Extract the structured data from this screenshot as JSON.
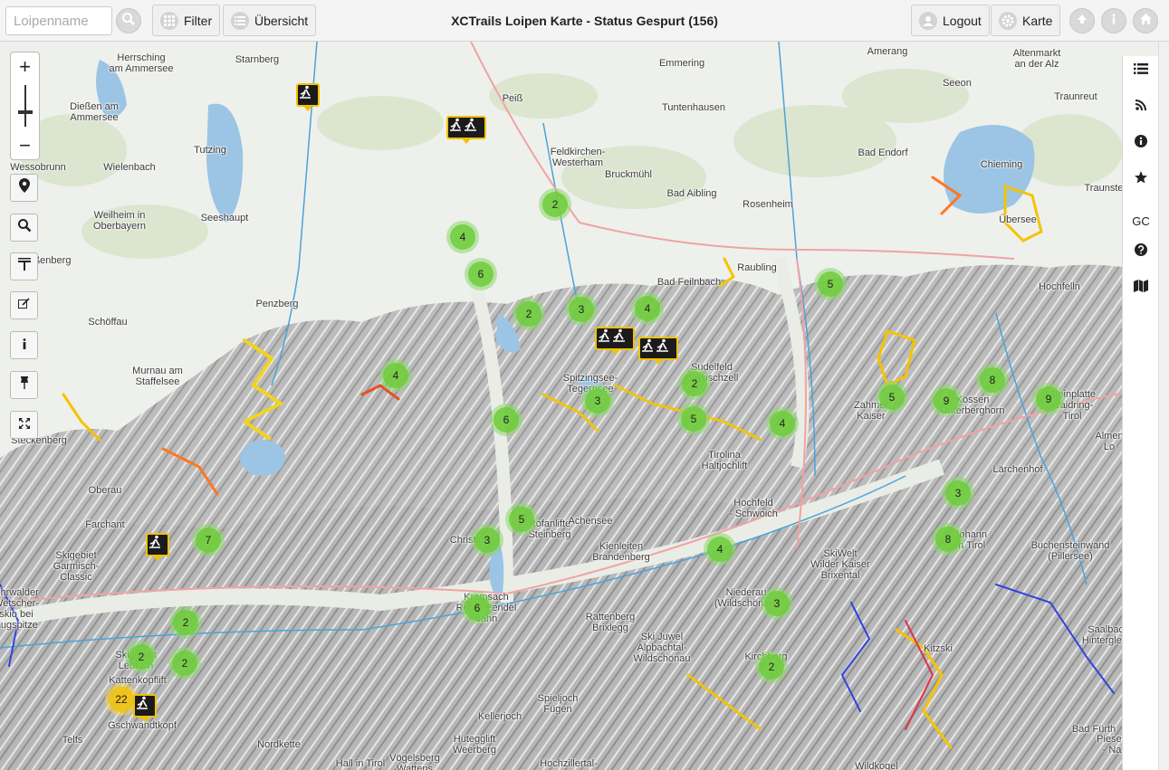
{
  "header": {
    "search_placeholder": "Loipenname",
    "filter_label": "Filter",
    "overview_label": "Übersicht",
    "title": "XCTrails Loipen Karte - Status Gespurt (156)",
    "logout_label": "Logout",
    "map_label": "Karte"
  },
  "map": {
    "zoom_in": "+",
    "zoom_out": "−",
    "places": [
      {
        "name": "Herrsching\nam Ammersee"
      },
      {
        "name": "Starnberg"
      },
      {
        "name": "Dießen am\nAmmersee"
      },
      {
        "name": "Wessobrunn"
      },
      {
        "name": "Wielenbach"
      },
      {
        "name": "Tutzing"
      },
      {
        "name": "Weilheim in\nOberbayern"
      },
      {
        "name": "Seeshaupt"
      },
      {
        "name": "Peißenberg"
      },
      {
        "name": "Penzberg"
      },
      {
        "name": "Schöffau"
      },
      {
        "name": "Murnau am\nStaffelsee"
      },
      {
        "name": "Peiß"
      },
      {
        "name": "Feldkirchen-\nWesterham"
      },
      {
        "name": "Bruckmühl"
      },
      {
        "name": "Bad Aibling"
      },
      {
        "name": "Emmering"
      },
      {
        "name": "Tuntenhausen"
      },
      {
        "name": "Rosenheim"
      },
      {
        "name": "Bad Endorf"
      },
      {
        "name": "Amerang"
      },
      {
        "name": "Seeon"
      },
      {
        "name": "Altenmarkt\nan der Alz"
      },
      {
        "name": "Traunreut"
      },
      {
        "name": "Chieming"
      },
      {
        "name": "Traunste"
      },
      {
        "name": "Übersee"
      },
      {
        "name": "Raubling"
      },
      {
        "name": "Bad Feilnbach"
      },
      {
        "name": "Hochfelln"
      },
      {
        "name": "Spitzingsee-\nTegernsee"
      },
      {
        "name": "Sudelfeld\nBayrischzell"
      },
      {
        "name": "Tirolina\nHaltjochlift"
      },
      {
        "name": "Zahmer\nKaiser"
      },
      {
        "name": "Kössen\nUnterberghorn"
      },
      {
        "name": "Steinplatte\nWaidring-\nTirol"
      },
      {
        "name": "Lärchenhof"
      },
      {
        "name": "Almen\nLo"
      },
      {
        "name": "Steckenberg"
      },
      {
        "name": "Oberau"
      },
      {
        "name": "Farchant"
      },
      {
        "name": "Skigebiet\nGarmisch-\nClassic"
      },
      {
        "name": "Ehrwalder\nWetscher-\nskio bei\nZugspitze"
      },
      {
        "name": "Skigebiet\nLeutsch"
      },
      {
        "name": "Kattenkopflift"
      },
      {
        "name": "Gschwandtkopf"
      },
      {
        "name": "Telfs"
      },
      {
        "name": "Christlum"
      },
      {
        "name": "Rofanlifte\nSteinberg"
      },
      {
        "name": "Achensee"
      },
      {
        "name": "Kienleiten\nBrandenberg"
      },
      {
        "name": "Hochfeld\n- Schwoich"
      },
      {
        "name": "SkiWelt\nWilder Kaiser\nBrixental"
      },
      {
        "name": "Johann\nin Tirol"
      },
      {
        "name": "Buchensteinwand\n(Pillersee)"
      },
      {
        "name": "Kramsach\nRofan Pendel\nbahn"
      },
      {
        "name": "Rattenberg\nBrixlegg"
      },
      {
        "name": "Niederau\n(Wildschönau)"
      },
      {
        "name": "Ski Juwel\nAlpbachtal-\nWildschönau"
      },
      {
        "name": "Kitzski"
      },
      {
        "name": "Saalbach-\nHinterglemm"
      },
      {
        "name": "Kirchberg"
      },
      {
        "name": "Spieljoch\nFügen"
      },
      {
        "name": "Kellerjoch"
      },
      {
        "name": "Hütegglift\nWeerberg"
      },
      {
        "name": "Vögelsberg\nWattens"
      },
      {
        "name": "Nordkette"
      },
      {
        "name": "Hall in Tirol"
      },
      {
        "name": "Hochzillertal-"
      },
      {
        "name": "Wildkogel"
      },
      {
        "name": "Piesen\n- Na"
      },
      {
        "name": "Bad Fürth"
      }
    ],
    "clusters": [
      {
        "count": "2"
      },
      {
        "count": "4"
      },
      {
        "count": "6"
      },
      {
        "count": "2"
      },
      {
        "count": "3"
      },
      {
        "count": "4"
      },
      {
        "count": "4"
      },
      {
        "count": "3"
      },
      {
        "count": "2"
      },
      {
        "count": "6"
      },
      {
        "count": "5"
      },
      {
        "count": "4"
      },
      {
        "count": "5"
      },
      {
        "count": "5"
      },
      {
        "count": "9"
      },
      {
        "count": "8"
      },
      {
        "count": "9"
      },
      {
        "count": "3"
      },
      {
        "count": "8"
      },
      {
        "count": "7"
      },
      {
        "count": "5"
      },
      {
        "count": "3"
      },
      {
        "count": "4"
      },
      {
        "count": "6"
      },
      {
        "count": "3"
      },
      {
        "count": "2"
      },
      {
        "count": "2"
      },
      {
        "count": "2"
      },
      {
        "count": "2"
      },
      {
        "count": "22"
      }
    ]
  },
  "side": {
    "gc_label": "GC"
  },
  "colors": {
    "cluster_green": "#6ecc39",
    "cluster_yellow": "#f0c20c",
    "marker_border": "#f2c200",
    "water": "#9cc4e4"
  }
}
